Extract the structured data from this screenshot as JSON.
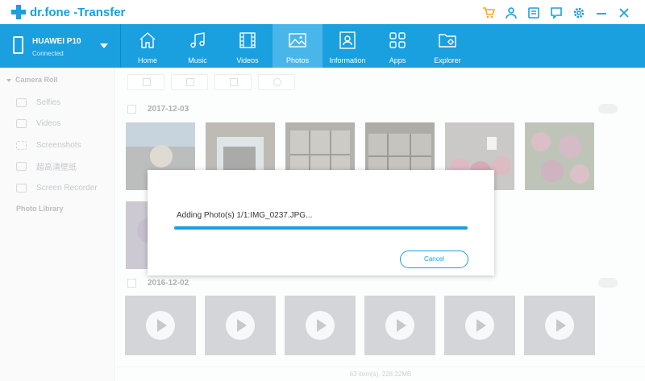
{
  "app": {
    "brand": "dr.fone",
    "module": "-Transfer",
    "title_icons": [
      "cart-icon",
      "user-icon",
      "register-icon",
      "feedback-icon",
      "settings-icon",
      "minimize-icon",
      "close-icon"
    ]
  },
  "device": {
    "name": "HUAWEI P10",
    "status": "Connected"
  },
  "tabs": [
    {
      "label": "Home",
      "icon": "home-icon"
    },
    {
      "label": "Music",
      "icon": "music-icon"
    },
    {
      "label": "Videos",
      "icon": "videos-icon"
    },
    {
      "label": "Photos",
      "icon": "photos-icon",
      "active": true
    },
    {
      "label": "Information",
      "icon": "information-icon"
    },
    {
      "label": "Apps",
      "icon": "apps-icon"
    },
    {
      "label": "Explorer",
      "icon": "explorer-icon"
    }
  ],
  "sidebar": {
    "header": "Camera Roll",
    "items": [
      {
        "label": "Selfies"
      },
      {
        "label": "Videos"
      },
      {
        "label": "Screenshots"
      },
      {
        "label": "超高清壁纸"
      },
      {
        "label": "Screen Recorder"
      }
    ],
    "library": "Photo Library"
  },
  "groups": [
    {
      "date": "2017-12-03"
    },
    {
      "date": "2016-12-02"
    }
  ],
  "footer": {
    "summary": "63 item(s), 228.22MB"
  },
  "dialog": {
    "message": "Adding Photo(s) 1/1:IMG_0237.JPG...",
    "progress": 1.0,
    "cancel_label": "Cancel"
  },
  "colors": {
    "accent": "#1a9fdf",
    "active_tab": "#49b6ea"
  }
}
